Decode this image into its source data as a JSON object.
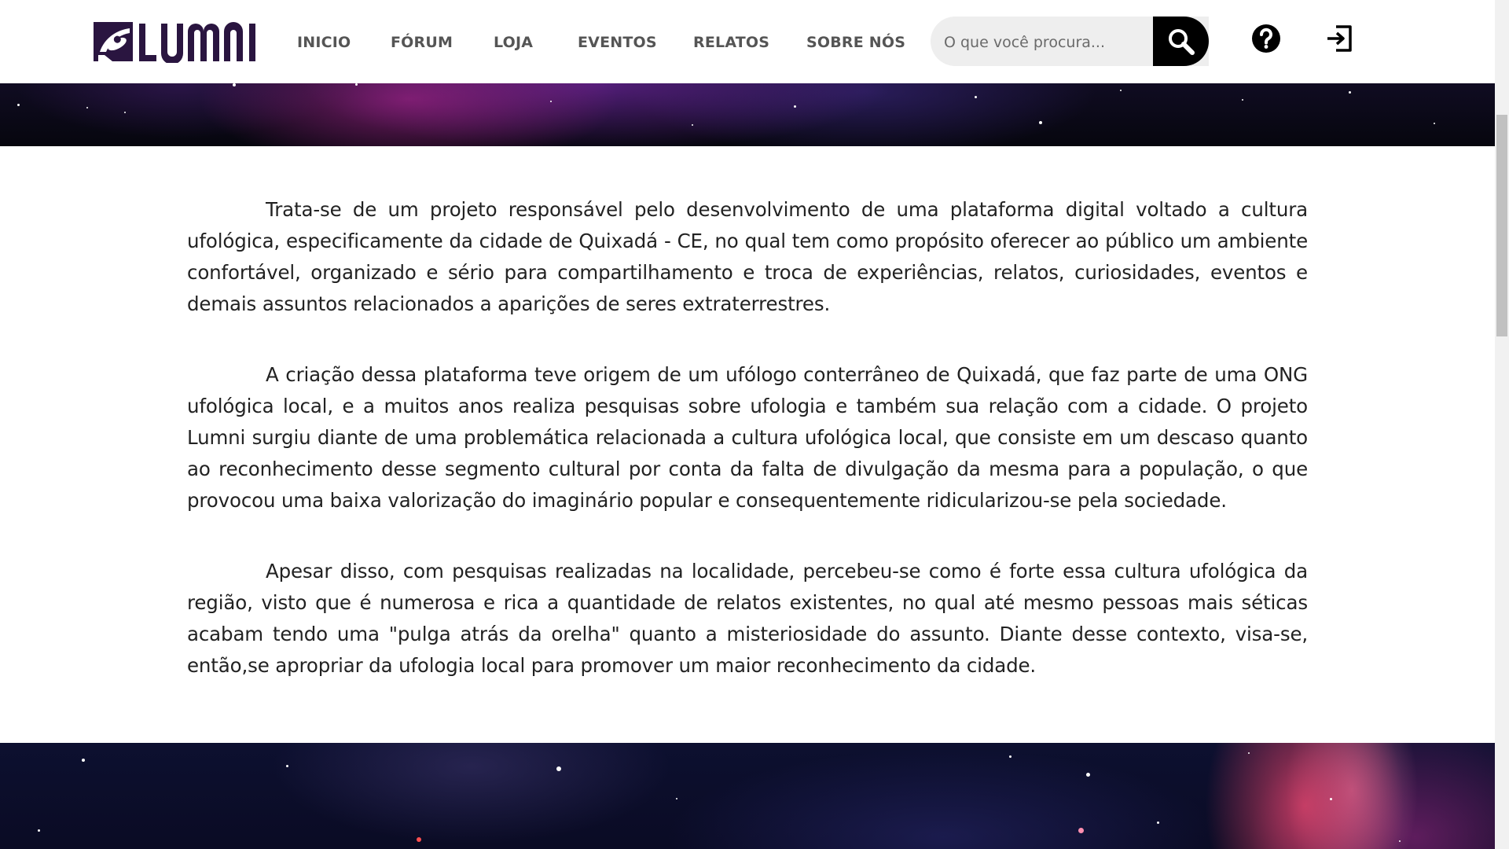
{
  "header": {
    "logo_text": "LUMNI",
    "nav": [
      {
        "label": "INICIO"
      },
      {
        "label": "FÓRUM"
      },
      {
        "label": "LOJA"
      },
      {
        "label": "EVENTOS"
      },
      {
        "label": "RELATOS"
      },
      {
        "label": "SOBRE NÓS"
      }
    ],
    "search": {
      "placeholder": "O que você procura...",
      "value": ""
    },
    "icons": {
      "search": "search-icon",
      "help": "help-icon",
      "login": "login-icon"
    }
  },
  "content": {
    "paragraphs": [
      "Trata-se de um projeto responsável pelo desenvolvimento de uma plataforma digital voltado a cultura ufológica, especificamente da cidade de Quixadá - CE, no qual tem como propósito oferecer ao público um ambiente confortável, organizado e sério para compartilhamento e troca de experiências, relatos, curiosidades, eventos e demais assuntos relacionados a aparições de seres extraterrestres.",
      "A criação dessa plataforma teve origem de um ufólogo conterrâneo de Quixadá, que faz parte de uma ONG ufológica local, e a muitos anos realiza pesquisas sobre ufologia e também sua relação com a cidade. O projeto Lumni surgiu diante de uma problemática relacionada a cultura ufológica local, que consiste em um descaso quanto ao reconhecimento desse segmento cultural por conta da falta de divulgação da mesma para a população, o que provocou uma baixa valorização do imaginário popular e consequentemente ridicularizou-se pela sociedade.",
      "Apesar disso, com pesquisas realizadas na localidade, percebeu-se como é forte essa cultura ufológica da região, visto que é numerosa e rica a quantidade de relatos existentes, no qual até mesmo pessoas mais séticas acabam tendo uma \"pulga atrás da orelha\" quanto a misteriosidade do assunto. Diante desse contexto, visa-se, então,se apropriar da ufologia local para promover um maior reconhecimento da cidade."
    ]
  },
  "colors": {
    "brand": "#2a1540",
    "nav_text": "#555555",
    "body_text": "#222222",
    "search_bg": "#eeeeee",
    "search_button": "#000000"
  }
}
